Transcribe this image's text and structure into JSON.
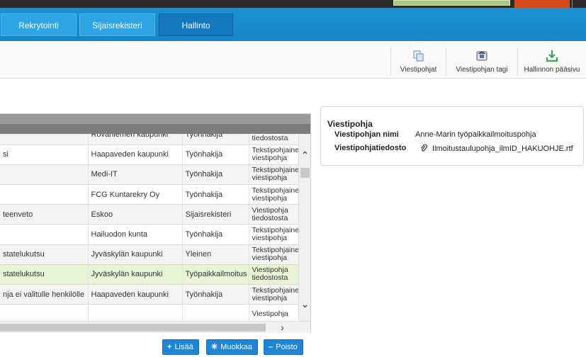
{
  "nav": {
    "tabs": [
      {
        "label": "Rekrytointi"
      },
      {
        "label": "Sijaisrekisteri"
      },
      {
        "label": "Hallinto"
      }
    ]
  },
  "toolbar": {
    "items": [
      {
        "label": "Viestipohjat",
        "icon": "templates-icon"
      },
      {
        "label": "Viestipohjan tagi",
        "icon": "tag-icon"
      },
      {
        "label": "Hallinnon pääsivu",
        "icon": "download-icon"
      }
    ]
  },
  "grid": {
    "rows": [
      {
        "name": "",
        "org": "Rovaniemen kaupunki",
        "type": "Työnhakija",
        "kind": "Viestipohja tiedostosta"
      },
      {
        "name": "si",
        "org": "Haapaveden kaupunki",
        "type": "Työnhakija",
        "kind": "Tekstipohjainen viestipohja"
      },
      {
        "name": "",
        "org": "Medi-IT",
        "type": "Työnhakija",
        "kind": "Tekstipohjainen viestipohja"
      },
      {
        "name": "",
        "org": "FCG Kuntarekry Oy",
        "type": "Työnhakija",
        "kind": "Tekstipohjainen viestipohja"
      },
      {
        "name": "teenveto",
        "org": "Eskoo",
        "type": "Sijaisrekisteri",
        "kind": "Viestipohja tiedostosta"
      },
      {
        "name": "",
        "org": "Hailuodon kunta",
        "type": "Työnhakija",
        "kind": "Tekstipohjainen viestipohja"
      },
      {
        "name": "statelukutsu",
        "org": "Jyväskylän kaupunki",
        "type": "Yleinen",
        "kind": "Tekstipohjainen viestipohja"
      },
      {
        "name": "statelukutsu",
        "org": "Jyväskylän kaupunki",
        "type": "Työpaikkailmoitus",
        "kind": "Viestipohja tiedostosta"
      },
      {
        "name": "nja ei valitulle henkilölle",
        "org": "Haapaveden kaupunki",
        "type": "Työnhakija",
        "kind": "Tekstipohjainen viestipohja"
      },
      {
        "name": "",
        "org": "",
        "type": "",
        "kind": "Viestipohja"
      }
    ]
  },
  "actions": {
    "add": "Lisää",
    "edit": "Muokkaa",
    "delete": "Poisto"
  },
  "detail": {
    "title": "Viestipohja",
    "name_label": "Viestipohjan nimi",
    "name_value": "Anne-Marin työpaikkailmoituspohja",
    "file_label": "Viestipohjatiedosto",
    "file_value": "Ilmoitustaulupohja_ilmID_HAKUOHJE.rtf"
  },
  "colors": {
    "nav": "#1585c6",
    "button": "#1f86d6",
    "selected_row": "#e8f3d6",
    "download_icon": "#3aa655"
  }
}
